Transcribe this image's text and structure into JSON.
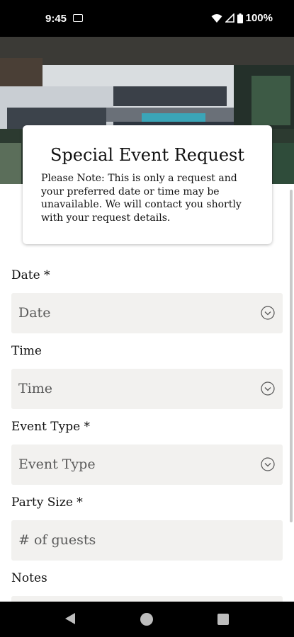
{
  "status_bar": {
    "time": "9:45",
    "battery": "100%"
  },
  "card": {
    "title": "Special Event Request",
    "note": "Please Note: This is only a request and your preferred date or time may be unavailable. We will contact you shortly with your request details."
  },
  "form": {
    "date": {
      "label": "Date *",
      "placeholder": "Date"
    },
    "time": {
      "label": "Time",
      "placeholder": "Time"
    },
    "event_type": {
      "label": "Event Type *",
      "placeholder": "Event Type"
    },
    "party_size": {
      "label": "Party Size *",
      "placeholder": "# of guests"
    },
    "notes": {
      "label": "Notes"
    }
  },
  "icons": {
    "dropdown": "chevron-down-circle-icon",
    "wifi": "wifi-icon",
    "signal": "cell-signal-icon",
    "battery": "battery-icon",
    "sim": "sim-icon"
  },
  "colors": {
    "field_bg": "#f2f1ef",
    "bars": "#000000"
  }
}
